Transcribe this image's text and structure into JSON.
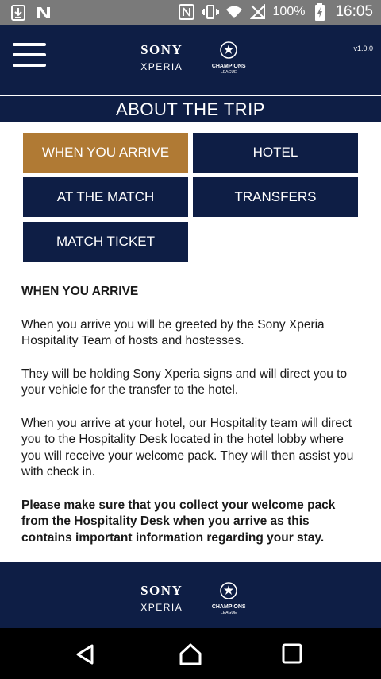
{
  "status_bar": {
    "battery_percent": "100%",
    "time": "16:05"
  },
  "header": {
    "menu_icon": "hamburger-menu-icon",
    "version": "v1.0.0",
    "brand": {
      "sony": "SONY",
      "xperia": "XPERIA",
      "ucl_title": "CHAMPIONS",
      "ucl_subtitle": "LEAGUE"
    }
  },
  "page_title": "ABOUT THE TRIP",
  "tabs": [
    {
      "label": "WHEN YOU ARRIVE",
      "active": true
    },
    {
      "label": "HOTEL",
      "active": false
    },
    {
      "label": "AT THE MATCH",
      "active": false
    },
    {
      "label": "TRANSFERS",
      "active": false
    },
    {
      "label": "MATCH TICKET",
      "active": false
    }
  ],
  "section": {
    "heading": "WHEN YOU ARRIVE",
    "paragraphs": [
      "When you arrive you will be greeted by the Sony Xperia Hospitality Team of hosts and hostesses.",
      "They will be holding Sony Xperia signs and will direct you to your vehicle for the transfer to the hotel.",
      "When you arrive at your hotel, our Hospitality team will direct you to the Hospitality Desk located in the hotel lobby where you will receive your welcome pack. They will then assist you with check in."
    ],
    "note": "Please make sure that you collect your welcome pack from the Hospitality Desk when you arrive as this contains important information regarding your stay."
  },
  "footer": {
    "brand": {
      "sony": "SONY",
      "xperia": "XPERIA",
      "ucl_title": "CHAMPIONS",
      "ucl_subtitle": "LEAGUE"
    }
  },
  "nav_bar": {
    "back_icon": "back-triangle-icon",
    "home_icon": "home-icon",
    "recents_icon": "recents-square-icon"
  },
  "colors": {
    "navy": "#0e1e45",
    "active_tab": "#b07a34",
    "status_bar": "#7a7a7a"
  }
}
